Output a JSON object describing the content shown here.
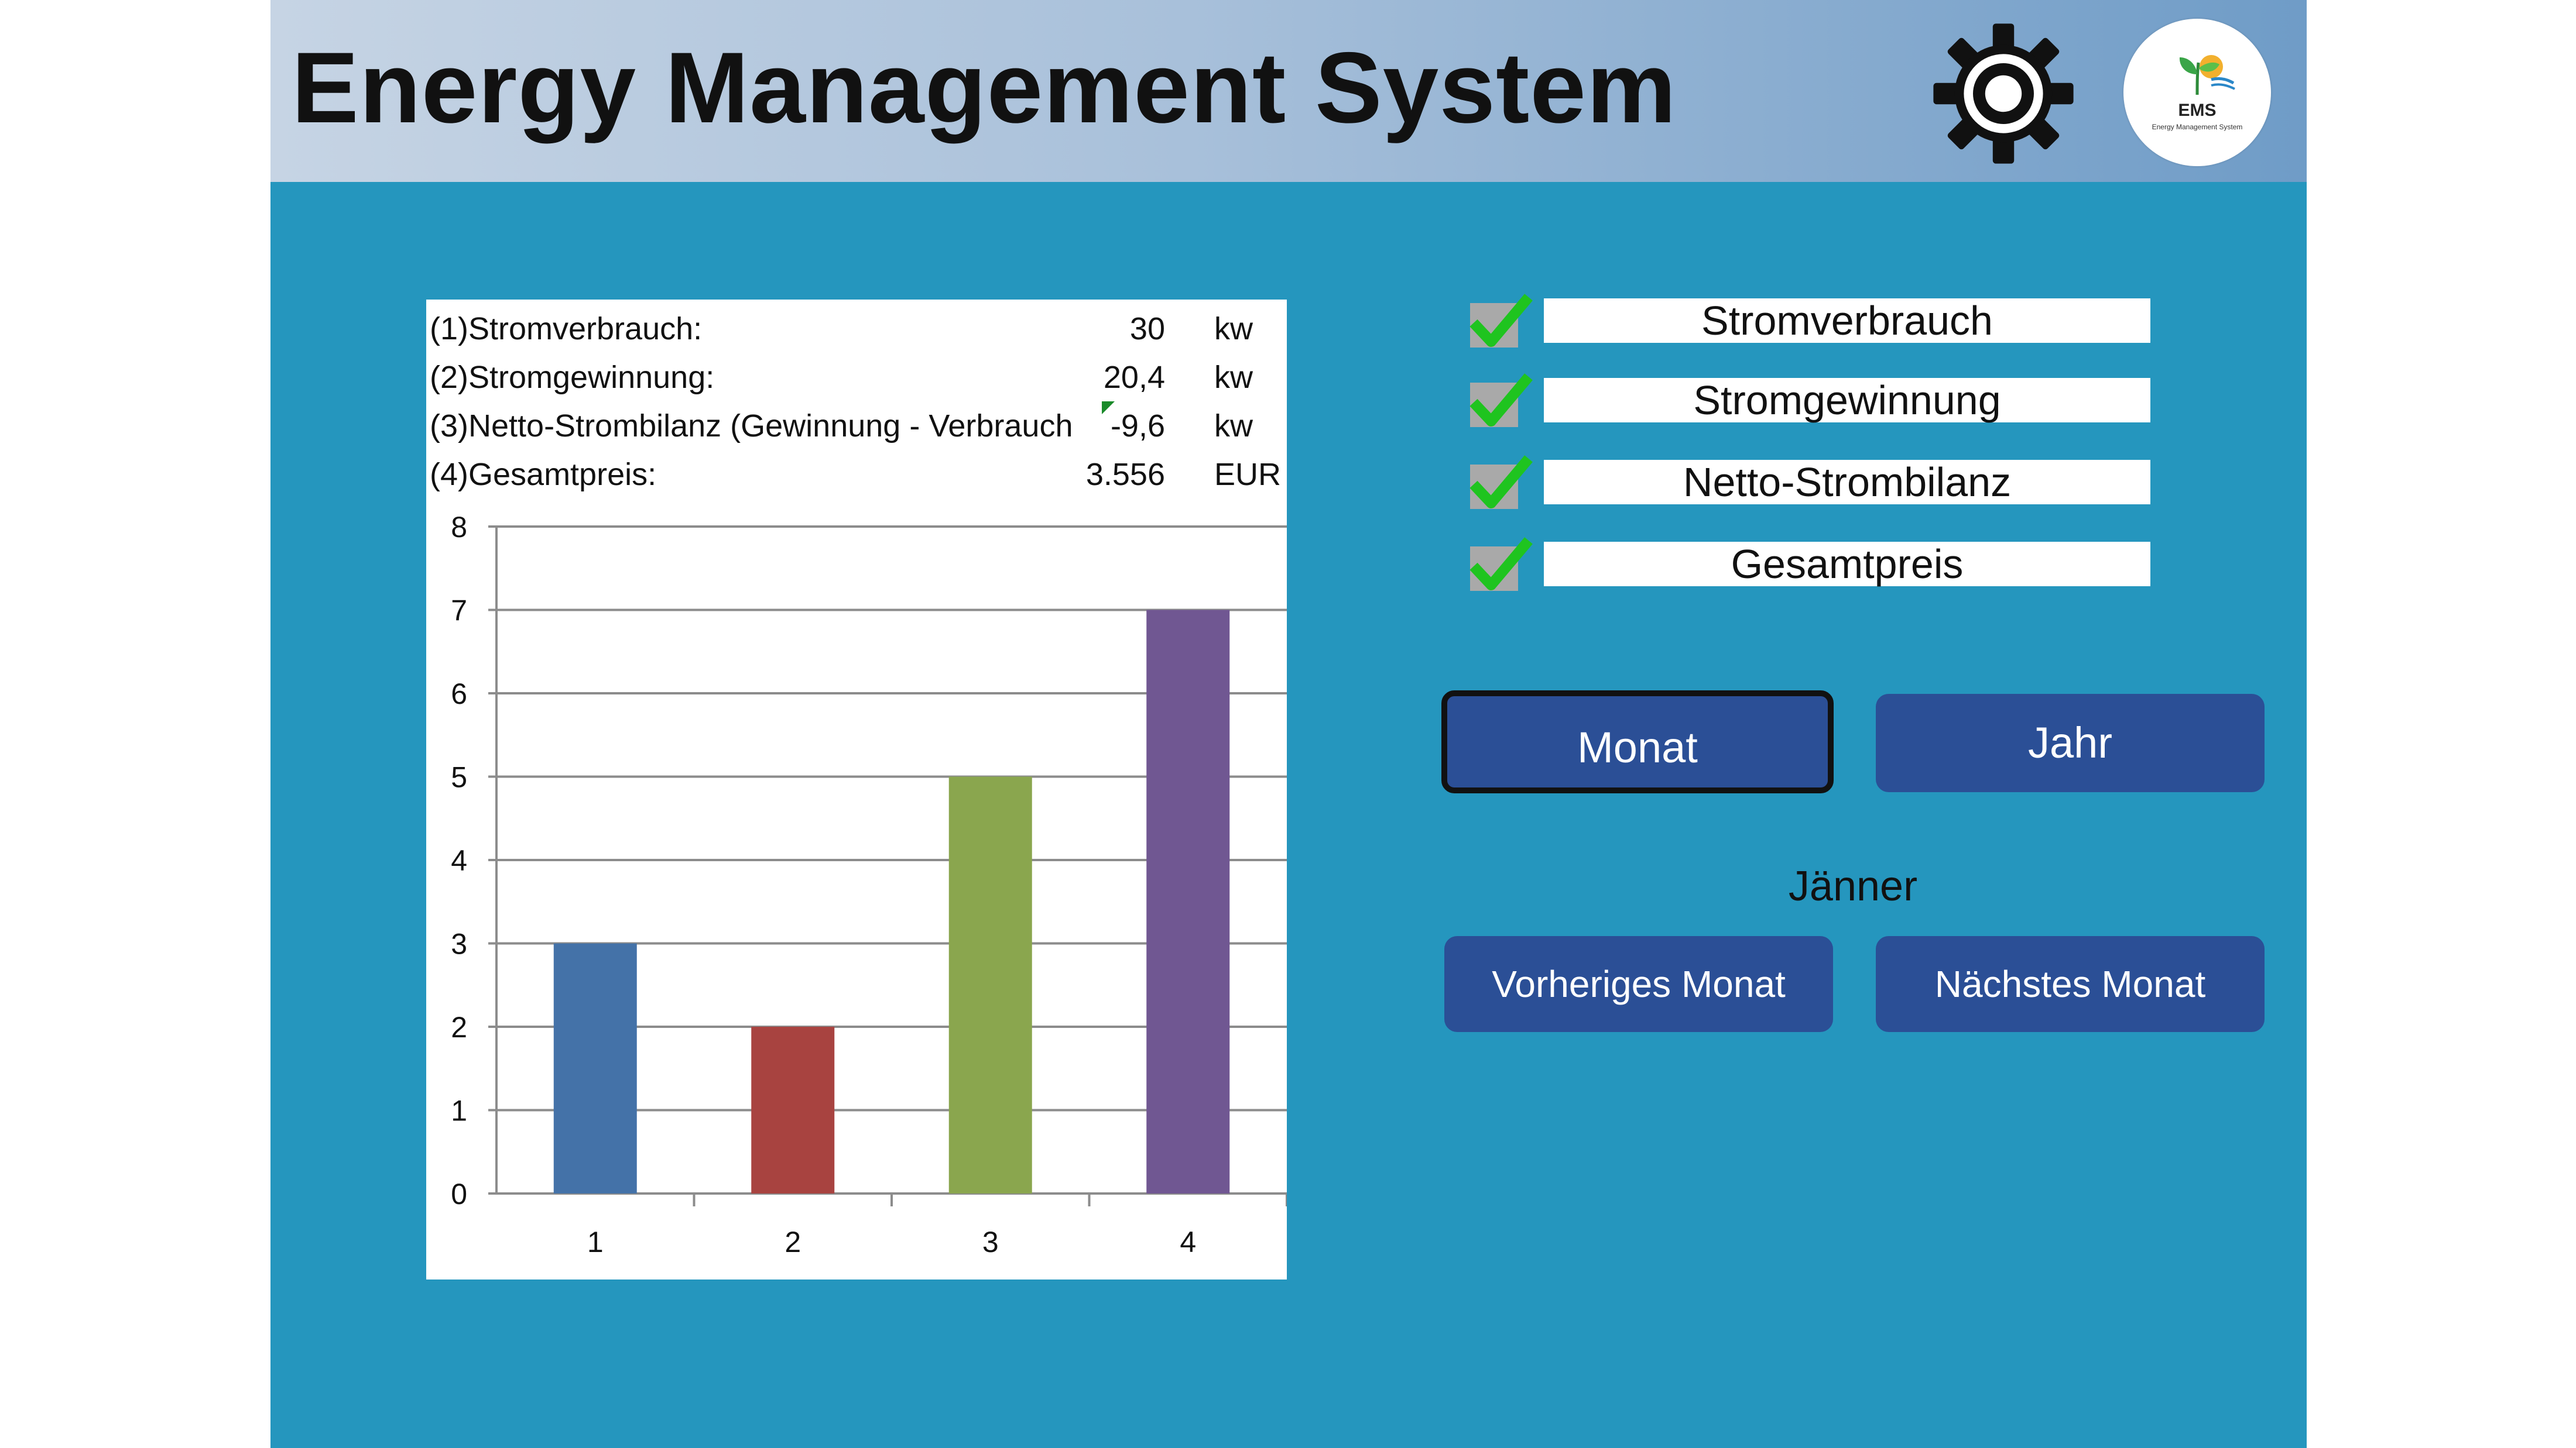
{
  "header": {
    "title": "Energy Management System",
    "settings_icon": "gear-icon",
    "logo": {
      "abbr": "EMS",
      "subtitle": "Energy Management System"
    }
  },
  "summary": [
    {
      "label": "(1)Stromverbrauch:",
      "value": "30",
      "unit": "kw"
    },
    {
      "label": "(2)Stromgewinnung:",
      "value": "20,4",
      "unit": "kw"
    },
    {
      "label": "(3)Netto-Strombilanz (Gewinnung - Verbrauch",
      "value": "-9,6",
      "unit": "kw"
    },
    {
      "label": "(4)Gesamtpreis:",
      "value": "3.556",
      "unit": "EUR"
    }
  ],
  "chart_data": {
    "type": "bar",
    "categories": [
      "1",
      "2",
      "3",
      "4"
    ],
    "values": [
      3,
      2,
      5,
      7
    ],
    "colors": [
      "#4472a8",
      "#a84340",
      "#8aa64e",
      "#705792"
    ],
    "ylim": [
      0,
      8
    ],
    "yticks": [
      "0",
      "1",
      "2",
      "3",
      "4",
      "5",
      "6",
      "7",
      "8"
    ],
    "grid": true
  },
  "series_toggles": [
    {
      "label": "Stromverbrauch",
      "checked": true
    },
    {
      "label": "Stromgewinnung",
      "checked": true
    },
    {
      "label": "Netto-Strombilanz",
      "checked": true
    },
    {
      "label": "Gesamtpreis",
      "checked": true
    }
  ],
  "period": {
    "month_button": "Monat",
    "year_button": "Jahr",
    "current": "Jänner",
    "prev_button": "Vorheriges Monat",
    "next_button": "Nächstes Monat"
  },
  "colors": {
    "background": "#2596be",
    "button": "#2b4f96",
    "check": "#1fc41f"
  }
}
